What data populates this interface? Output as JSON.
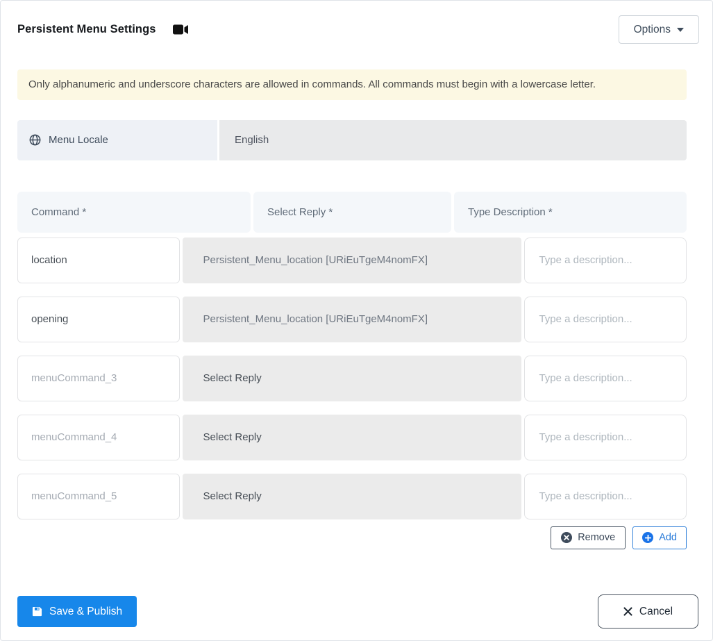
{
  "colors": {
    "primary_blue": "#1787ea",
    "add_blue": "#2779d8",
    "dark_slate": "#3e4b5b",
    "alert_bg": "#fcf8e3",
    "header_cell_bg": "#f4f7fa",
    "select_bg": "#ebebeb"
  },
  "header": {
    "title": "Persistent Menu Settings",
    "options_button": "Options"
  },
  "alert": {
    "message": "Only alphanumeric and underscore characters are allowed in commands. All commands must begin with a lowercase letter."
  },
  "locale": {
    "label": "Menu Locale",
    "value": "English"
  },
  "commands_table": {
    "headers": {
      "command": "Command *",
      "reply": "Select Reply *",
      "description": "Type Description *"
    },
    "rows": [
      {
        "command_value": "location",
        "command_placeholder": "",
        "reply": "Persistent_Menu_location [URiEuTgeM4nomFX]",
        "reply_is_selected": true,
        "description_value": "",
        "description_placeholder": "Type a description..."
      },
      {
        "command_value": "opening",
        "command_placeholder": "",
        "reply": "Persistent_Menu_location [URiEuTgeM4nomFX]",
        "reply_is_selected": true,
        "description_value": "",
        "description_placeholder": "Type a description..."
      },
      {
        "command_value": "",
        "command_placeholder": "menuCommand_3",
        "reply": "Select Reply",
        "reply_is_selected": false,
        "description_value": "",
        "description_placeholder": "Type a description..."
      },
      {
        "command_value": "",
        "command_placeholder": "menuCommand_4",
        "reply": "Select Reply",
        "reply_is_selected": false,
        "description_value": "",
        "description_placeholder": "Type a description..."
      },
      {
        "command_value": "",
        "command_placeholder": "menuCommand_5",
        "reply": "Select Reply",
        "reply_is_selected": false,
        "description_value": "",
        "description_placeholder": "Type a description..."
      }
    ]
  },
  "row_actions": {
    "remove_button": "Remove",
    "add_button": "Add"
  },
  "footer": {
    "save_button": "Save & Publish",
    "cancel_button": "Cancel"
  }
}
